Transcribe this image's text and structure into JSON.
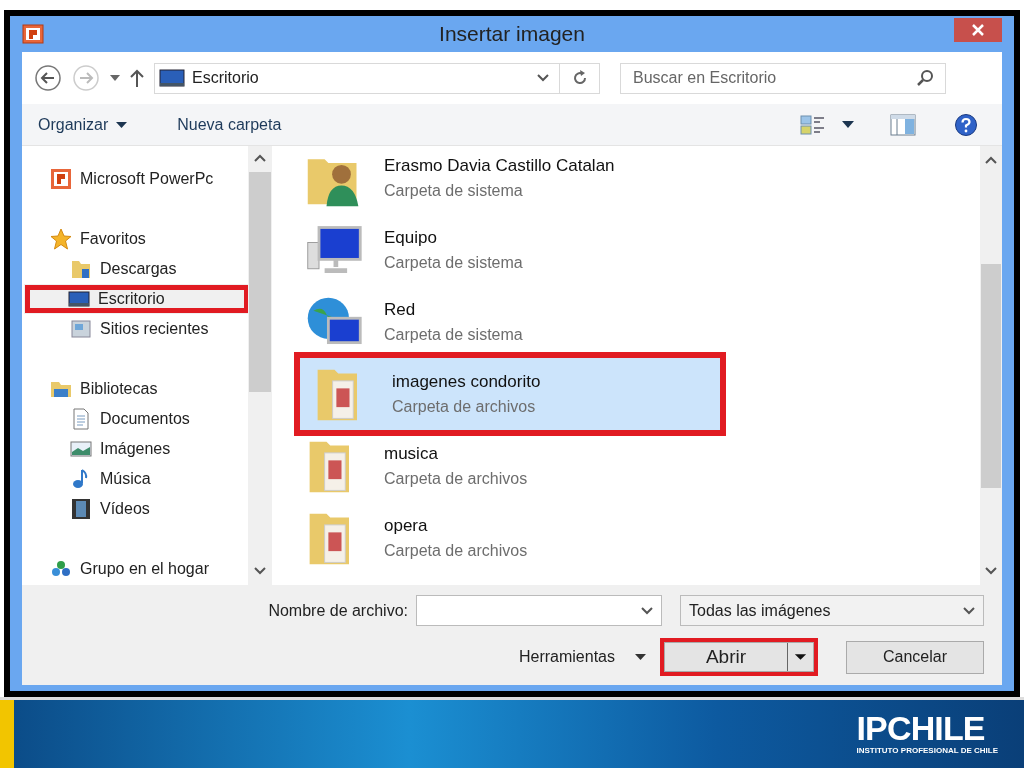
{
  "window": {
    "title": "Insertar imagen"
  },
  "address": {
    "location": "Escritorio"
  },
  "search": {
    "placeholder": "Buscar en Escritorio"
  },
  "toolbar": {
    "items": [
      {
        "label": "Organizar",
        "kind": "menu"
      },
      {
        "label": "Nueva carpeta",
        "kind": "button"
      }
    ]
  },
  "sidebar": {
    "items": [
      {
        "label": "Microsoft PowerPc",
        "selected": false
      },
      {
        "label": "Favoritos",
        "selected": false,
        "children": [
          {
            "label": "Descargas",
            "selected": false,
            "highlighted": false
          },
          {
            "label": "Escritorio",
            "selected": true,
            "highlighted": true
          },
          {
            "label": "Sitios recientes",
            "selected": false,
            "highlighted": false
          }
        ]
      },
      {
        "label": "Bibliotecas",
        "selected": false,
        "children": [
          {
            "label": "Documentos",
            "selected": false,
            "highlighted": false
          },
          {
            "label": "Imágenes",
            "selected": false,
            "highlighted": false
          },
          {
            "label": "Música",
            "selected": false,
            "highlighted": false
          },
          {
            "label": "Vídeos",
            "selected": false,
            "highlighted": false
          }
        ]
      },
      {
        "label": "Grupo en el hogar",
        "selected": false
      }
    ]
  },
  "files": [
    {
      "name": "Erasmo Davia Castillo Catalan",
      "type": "Carpeta de sistema",
      "selected": false,
      "highlighted": false
    },
    {
      "name": "Equipo",
      "type": "Carpeta de sistema",
      "selected": false,
      "highlighted": false
    },
    {
      "name": "Red",
      "type": "Carpeta de sistema",
      "selected": false,
      "highlighted": false
    },
    {
      "name": "imagenes condorito",
      "type": "Carpeta de archivos",
      "selected": true,
      "highlighted": true
    },
    {
      "name": "musica",
      "type": "Carpeta de archivos",
      "selected": false,
      "highlighted": false
    },
    {
      "name": "opera",
      "type": "Carpeta de archivos",
      "selected": false,
      "highlighted": false
    }
  ],
  "footer": {
    "filename_label": "Nombre de archivo:",
    "filter": "Todas las imágenes",
    "tools": "Herramientas",
    "open": {
      "label": "Abrir",
      "highlighted": true
    },
    "cancel": "Cancelar"
  },
  "banner": {
    "logo": "IPCHILE",
    "tagline": "INSTITUTO PROFESIONAL DE CHILE"
  }
}
